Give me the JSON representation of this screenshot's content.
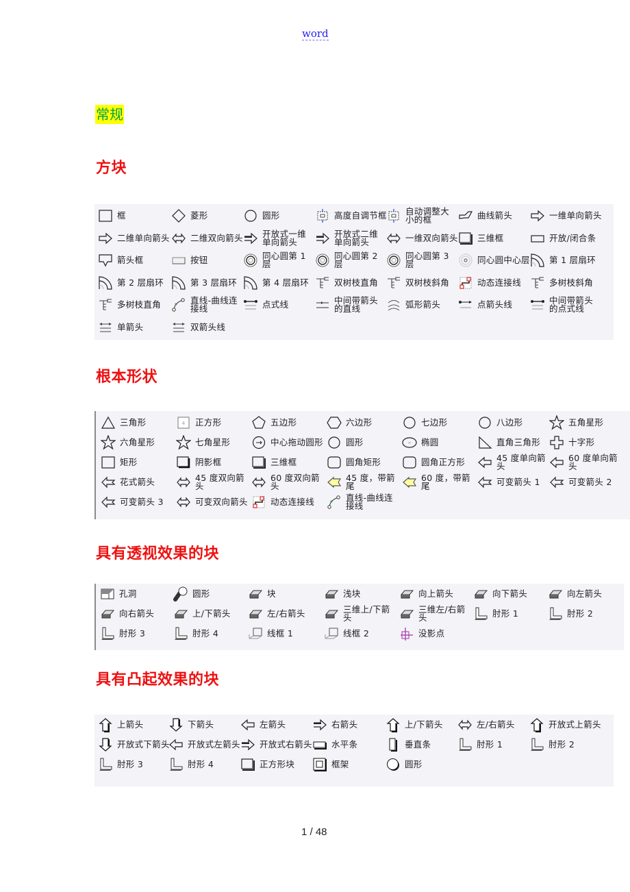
{
  "header": {
    "link_text": "word"
  },
  "general_heading": "常规",
  "sections": [
    {
      "title": "方块",
      "items": [
        {
          "label": "框",
          "icon": "box-icon"
        },
        {
          "label": "菱形",
          "icon": "diamond-icon"
        },
        {
          "label": "圆形",
          "icon": "circle-icon"
        },
        {
          "label": "高度自调节框",
          "icon": "auto-height-box-icon"
        },
        {
          "label": "自动调整大小的框",
          "icon": "auto-size-box-icon"
        },
        {
          "label": "曲线箭头",
          "icon": "curved-arrow-icon"
        },
        {
          "label": "一维单向箭头",
          "icon": "arrow-right-outline-icon"
        },
        {
          "label": "二维单向箭头",
          "icon": "arrow-right-2d-icon"
        },
        {
          "label": "二维双向箭头",
          "icon": "arrow-double-2d-icon"
        },
        {
          "label": "开放式一维单向箭头",
          "icon": "open-arrow-1d-icon"
        },
        {
          "label": "开放式二维单向箭头",
          "icon": "open-arrow-2d-icon"
        },
        {
          "label": "一维双向箭头",
          "icon": "arrow-double-1d-icon"
        },
        {
          "label": "三维框",
          "icon": "box-3d-icon"
        },
        {
          "label": "开放/闭合条",
          "icon": "open-close-bar-icon"
        },
        {
          "label": "箭头框",
          "icon": "arrow-box-icon"
        },
        {
          "label": "按钮",
          "icon": "button-shape-icon"
        },
        {
          "label": "同心圆第 1 层",
          "icon": "concentric-1-icon"
        },
        {
          "label": "同心圆第 2 层",
          "icon": "concentric-2-icon"
        },
        {
          "label": "同心圆第 3 层",
          "icon": "concentric-3-icon"
        },
        {
          "label": "同心圆中心层",
          "icon": "concentric-center-icon"
        },
        {
          "label": "第 1 层扇环",
          "icon": "sector-1-icon"
        },
        {
          "label": "第 2 层扇环",
          "icon": "sector-2-icon"
        },
        {
          "label": "第 3 层扇环",
          "icon": "sector-3-icon"
        },
        {
          "label": "第 4 层扇环",
          "icon": "sector-4-icon"
        },
        {
          "label": "双树枝直角",
          "icon": "double-tree-right-icon"
        },
        {
          "label": "双树枝斜角",
          "icon": "double-tree-oblique-icon"
        },
        {
          "label": "动态连接线",
          "icon": "dynamic-connector-icon"
        },
        {
          "label": "多树枝斜角",
          "icon": "multi-tree-oblique-icon"
        },
        {
          "label": "多树枝直角",
          "icon": "multi-tree-right-icon"
        },
        {
          "label": "直线-曲线连接线",
          "icon": "line-curve-connector-icon"
        },
        {
          "label": "点式线",
          "icon": "dot-line-icon"
        },
        {
          "label": "中间带箭头的直线",
          "icon": "mid-arrow-line-icon"
        },
        {
          "label": "弧形箭头",
          "icon": "arc-arrow-icon"
        },
        {
          "label": "点箭头线",
          "icon": "dot-arrow-line-icon"
        },
        {
          "label": "中间带箭头的点式线",
          "icon": "mid-arrow-dot-line-icon"
        },
        {
          "label": "单箭头",
          "icon": "single-arrow-line-icon"
        },
        {
          "label": "双箭头线",
          "icon": "double-arrow-line-icon"
        }
      ]
    },
    {
      "title": "根本形状",
      "items": [
        {
          "label": "三角形",
          "icon": "triangle-icon"
        },
        {
          "label": "正方形",
          "icon": "square-icon"
        },
        {
          "label": "五边形",
          "icon": "pentagon-icon"
        },
        {
          "label": "六边形",
          "icon": "hexagon-icon"
        },
        {
          "label": "七边形",
          "icon": "heptagon-icon"
        },
        {
          "label": "八边形",
          "icon": "octagon-icon"
        },
        {
          "label": "五角星形",
          "icon": "star5-icon"
        },
        {
          "label": "六角星形",
          "icon": "star6-icon"
        },
        {
          "label": "七角星形",
          "icon": "star7-icon"
        },
        {
          "label": "中心拖动圆形",
          "icon": "center-drag-circle-icon"
        },
        {
          "label": "圆形",
          "icon": "circle-icon"
        },
        {
          "label": "椭圆",
          "icon": "ellipse-icon"
        },
        {
          "label": "直角三角形",
          "icon": "right-triangle-icon"
        },
        {
          "label": "十字形",
          "icon": "cross-icon"
        },
        {
          "label": "矩形",
          "icon": "rectangle-icon"
        },
        {
          "label": "阴影框",
          "icon": "shadow-box-icon"
        },
        {
          "label": "三维框",
          "icon": "box-3d-icon"
        },
        {
          "label": "圆角矩形",
          "icon": "rounded-rect-icon"
        },
        {
          "label": "圆角正方形",
          "icon": "rounded-square-icon"
        },
        {
          "label": "45 度单向箭头",
          "icon": "arrow-45-single-icon"
        },
        {
          "label": "60 度单向箭头",
          "icon": "arrow-60-single-icon"
        },
        {
          "label": "花式箭头",
          "icon": "fancy-arrow-icon"
        },
        {
          "label": "45 度双向箭头",
          "icon": "arrow-45-double-icon"
        },
        {
          "label": "60 度双向箭头",
          "icon": "arrow-60-double-icon"
        },
        {
          "label": "45 度，带箭尾",
          "icon": "arrow-45-tail-icon"
        },
        {
          "label": "60 度，带箭尾",
          "icon": "arrow-60-tail-icon"
        },
        {
          "label": "可变箭头 1",
          "icon": "variable-arrow-1-icon"
        },
        {
          "label": "可变箭头 2",
          "icon": "variable-arrow-2-icon"
        },
        {
          "label": "可变箭头 3",
          "icon": "variable-arrow-3-icon"
        },
        {
          "label": "可变双向箭头",
          "icon": "variable-double-arrow-icon"
        },
        {
          "label": "动态连接线",
          "icon": "dynamic-connector-icon"
        },
        {
          "label": "直线-曲线连接线",
          "icon": "line-curve-connector-icon"
        }
      ]
    },
    {
      "title": "具有透视效果的块",
      "items": [
        {
          "label": "孔洞",
          "icon": "hole-icon"
        },
        {
          "label": "圆形",
          "icon": "cylinder-icon"
        },
        {
          "label": "块",
          "icon": "block-icon"
        },
        {
          "label": "浅块",
          "icon": "shallow-block-icon"
        },
        {
          "label": "向上箭头",
          "icon": "persp-up-arrow-icon"
        },
        {
          "label": "向下箭头",
          "icon": "persp-down-arrow-icon"
        },
        {
          "label": "向左箭头",
          "icon": "persp-left-arrow-icon"
        },
        {
          "label": "向右箭头",
          "icon": "persp-right-arrow-icon"
        },
        {
          "label": "上/下箭头",
          "icon": "persp-updown-arrow-icon"
        },
        {
          "label": "左/右箭头",
          "icon": "persp-leftright-arrow-icon"
        },
        {
          "label": "三维上/下箭头",
          "icon": "persp-3d-updown-icon"
        },
        {
          "label": "三维左/右箭头",
          "icon": "persp-3d-leftright-icon"
        },
        {
          "label": "肘形 1",
          "icon": "persp-elbow-1-icon"
        },
        {
          "label": "肘形 2",
          "icon": "persp-elbow-2-icon"
        },
        {
          "label": "肘形 3",
          "icon": "persp-elbow-3-icon"
        },
        {
          "label": "肘形 4",
          "icon": "persp-elbow-4-icon"
        },
        {
          "label": "线框 1",
          "icon": "wireframe-1-icon"
        },
        {
          "label": "线框 2",
          "icon": "wireframe-2-icon"
        },
        {
          "label": "没影点",
          "icon": "vanishing-point-icon"
        }
      ]
    },
    {
      "title": "具有凸起效果的块",
      "items": [
        {
          "label": "上箭头",
          "icon": "raised-up-arrow-icon"
        },
        {
          "label": "下箭头",
          "icon": "raised-down-arrow-icon"
        },
        {
          "label": "左箭头",
          "icon": "raised-left-arrow-icon"
        },
        {
          "label": "右箭头",
          "icon": "raised-right-arrow-icon"
        },
        {
          "label": "上/下箭头",
          "icon": "raised-updown-arrow-icon"
        },
        {
          "label": "左/右箭头",
          "icon": "raised-leftright-arrow-icon"
        },
        {
          "label": "开放式上箭头",
          "icon": "open-up-arrow-icon"
        },
        {
          "label": "开放式下箭头",
          "icon": "open-down-arrow-icon"
        },
        {
          "label": "开放式左箭头",
          "icon": "open-left-arrow-icon"
        },
        {
          "label": "开放式右箭头",
          "icon": "open-right-arrow-icon"
        },
        {
          "label": "水平条",
          "icon": "horizontal-bar-icon"
        },
        {
          "label": "垂直条",
          "icon": "vertical-bar-icon"
        },
        {
          "label": "肘形 1",
          "icon": "raised-elbow-1-icon"
        },
        {
          "label": "肘形 2",
          "icon": "raised-elbow-2-icon"
        },
        {
          "label": "肘形 3",
          "icon": "raised-elbow-3-icon"
        },
        {
          "label": "肘形 4",
          "icon": "raised-elbow-4-icon"
        },
        {
          "label": "正方形块",
          "icon": "square-block-icon"
        },
        {
          "label": "框架",
          "icon": "frame-icon"
        },
        {
          "label": "圆形",
          "icon": "raised-circle-icon"
        }
      ]
    }
  ],
  "footer": {
    "page_number": "1 / 48"
  }
}
